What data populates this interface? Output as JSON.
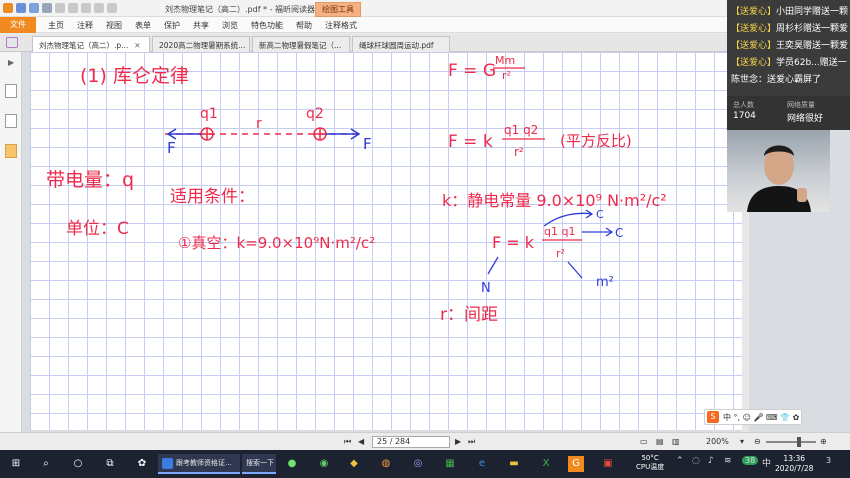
{
  "window": {
    "title": "刘杰物理笔记（高二）.pdf * - 福昕阅读器",
    "context_tab": "绘图工具"
  },
  "menu": {
    "file": "文件",
    "items": [
      "主页",
      "注释",
      "视图",
      "表单",
      "保护",
      "共享",
      "浏览",
      "特色功能",
      "帮助",
      "注释格式"
    ]
  },
  "tabs": [
    {
      "label": "刘杰物理笔记（高二）.p...",
      "active": true
    },
    {
      "label": "2020高二物理暑期系统..."
    },
    {
      "label": "新高二物理暑假笔记（..."
    },
    {
      "label": "绳球杆球圆周运动.pdf"
    }
  ],
  "live": {
    "messages": [
      {
        "gift": "【送爱心】",
        "text": "小田同学赠送一颗"
      },
      {
        "gift": "【送爱心】",
        "text": "周杉杉赠送一颗爱"
      },
      {
        "gift": "【送爱心】",
        "text": "王奕昊赠送一颗爱"
      },
      {
        "gift": "【送爱心】",
        "text": "学员62b...赠送一"
      },
      {
        "gift": "",
        "text": "陈世念：送爱心霸屏了"
      }
    ],
    "viewers_label": "总人数",
    "viewers_value": "1704",
    "network_label": "网络质量",
    "network_value": "网络很好"
  },
  "note": {
    "title": "(1) 库仑定律",
    "q1": "q1",
    "q2": "q2",
    "r": "r",
    "F_left": "F",
    "F_right": "F",
    "charge": "带电量：q",
    "unit": "单位：C",
    "condition": "适用条件：",
    "vacuum": "①真空：k=9.0×10⁹N·m²/c²",
    "gravity_F": "F = G",
    "gravity_num": "Mm",
    "gravity_den": "r²",
    "coulomb_F": "F = k",
    "coulomb_num": "q1 q2",
    "coulomb_den": "r²",
    "inverse_square": "(平方反比)",
    "k_def": "k：静电常量 9.0×10⁹ N·m²/c²",
    "c_label1": "C",
    "c_label2": "C",
    "F2": "F = k",
    "F2_num": "q1 q1",
    "F2_den": "r²",
    "N": "N",
    "m2": "m²",
    "r_def": "r：间距"
  },
  "status": {
    "page": "25 / 284",
    "zoom": "200%"
  },
  "sougou": {
    "logo": "S",
    "text": "中 °, ☺ 🎤 ⌨ 👕 ✿"
  },
  "taskbar": {
    "tasks": [
      {
        "label": "跟考教师资格证...",
        "color": "#3c7be0"
      },
      {
        "label": "搜索一下",
        "color": "#2a62c7"
      }
    ],
    "temp": "50°C",
    "temp_label": "CPU温度",
    "badge": "38",
    "time": "13:36",
    "date": "2020/7/28",
    "notif": "3"
  }
}
